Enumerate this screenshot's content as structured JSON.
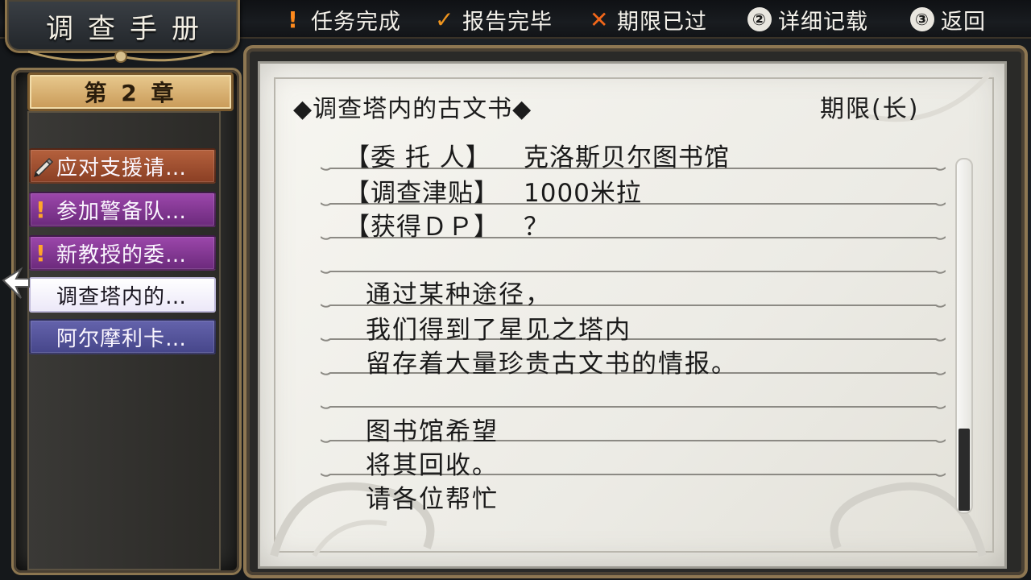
{
  "header": {
    "title": "调查手册",
    "legend": [
      {
        "icon": "exclamation-icon",
        "label": "任务完成"
      },
      {
        "icon": "check-icon",
        "label": "报告完毕"
      },
      {
        "icon": "cross-icon",
        "label": "期限已过"
      }
    ],
    "buttons": [
      {
        "key": "②",
        "label": "详细记载"
      },
      {
        "key": "③",
        "label": "返回"
      }
    ]
  },
  "sidebar": {
    "chapter": "第 2 章",
    "quests": [
      {
        "label": "应对支援请…",
        "status": "pencil"
      },
      {
        "label": "参加警备队…",
        "status": "exclamation"
      },
      {
        "label": "新教授的委…",
        "status": "exclamation"
      },
      {
        "label": "调查塔内的…",
        "status": "selected"
      },
      {
        "label": "阿尔摩利卡…",
        "status": "none"
      }
    ]
  },
  "detail": {
    "title": "◆调查塔内的古文书◆",
    "deadline": "期限(长)",
    "fields": [
      {
        "label": "【委 托 人】",
        "value": "克洛斯贝尔图书馆"
      },
      {
        "label": "【调查津贴】",
        "value": "1000米拉"
      },
      {
        "label": "【获得ＤＰ】",
        "value": "？"
      }
    ],
    "description": [
      "通过某种途径，",
      "我们得到了星见之塔内",
      "留存着大量珍贵古文书的情报。",
      "",
      "图书馆希望",
      "将其回收。",
      "请各位帮忙"
    ]
  },
  "colors": {
    "accent_orange": "#ff8a1c",
    "quest_orange": "#b5613d",
    "quest_purple": "#9c47ab",
    "quest_blue": "#6463ac",
    "parchment": "#f2f1eb"
  }
}
